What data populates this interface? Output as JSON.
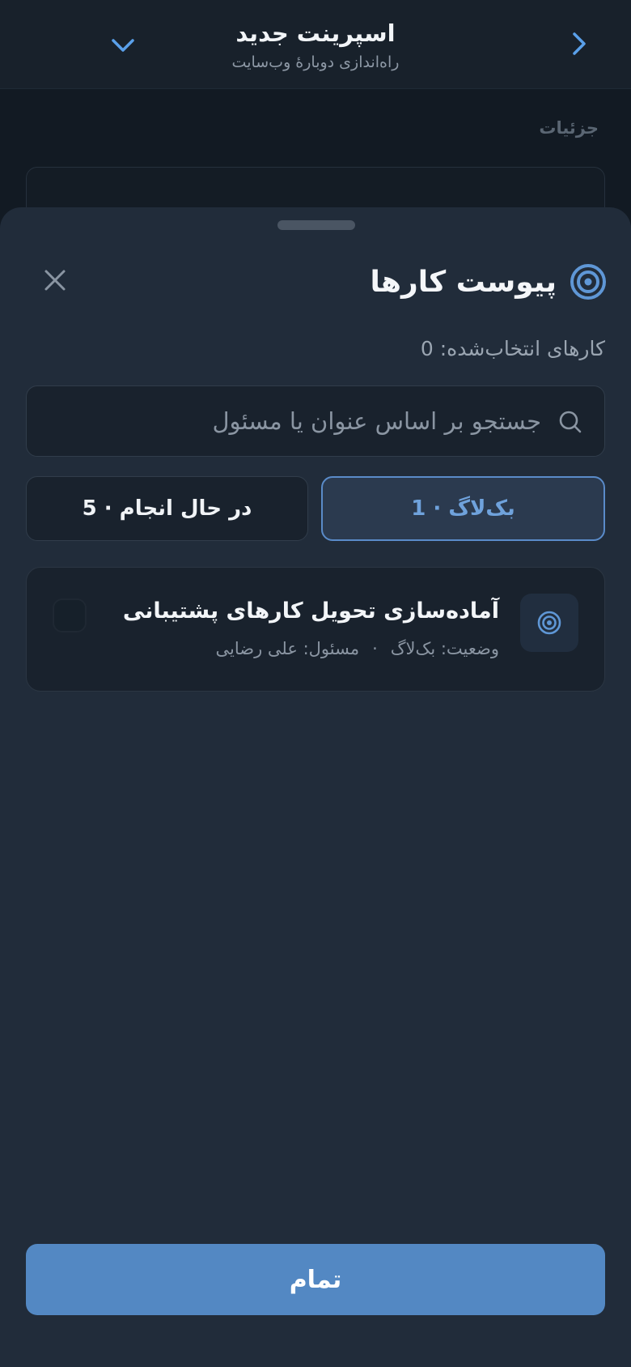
{
  "header": {
    "title": "اسپرینت جدید",
    "subtitle": "راه‌اندازی دوبارهٔ وب‌سایت",
    "back_icon": "chevron-right-icon",
    "dropdown_icon": "chevron-down-icon"
  },
  "background": {
    "details_label": "جزئیات"
  },
  "sheet": {
    "title": "پیوست کارها",
    "title_icon": "target-icon",
    "close_icon": "close-icon",
    "selected_count": "کارهای انتخاب‌شده: 0",
    "search": {
      "placeholder": "جستجو بر اساس عنوان یا مسئول",
      "value": ""
    },
    "tabs": [
      {
        "label": "بک‌لاگ · 1",
        "active": true
      },
      {
        "label": "در حال انجام · 5",
        "active": false
      }
    ],
    "tasks": [
      {
        "title": "آماده‌سازی تحویل کارهای پشتیبانی",
        "status": "وضعیت: بک‌لاگ",
        "separator": "·",
        "owner": "مسئول: علی رضایی",
        "checked": false
      }
    ],
    "done_label": "تمام"
  },
  "colors": {
    "accent": "#5388c3",
    "active_tab_text": "#6fa2dc",
    "sheet_bg": "#212c3a"
  }
}
